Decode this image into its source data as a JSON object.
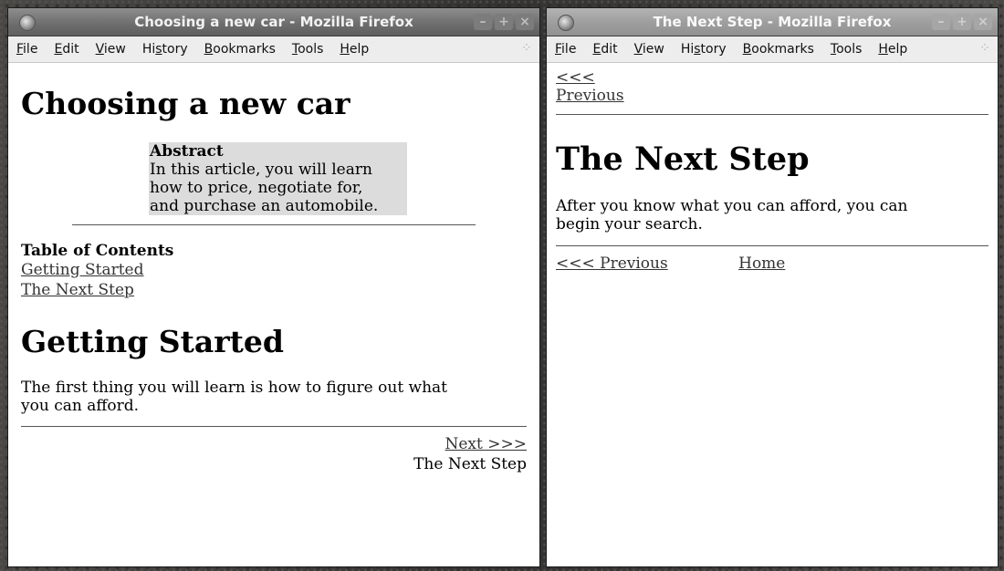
{
  "menu": {
    "items": [
      {
        "mnemonic": "F",
        "rest": "ile"
      },
      {
        "mnemonic": "E",
        "rest": "dit"
      },
      {
        "mnemonic": "V",
        "rest": "iew"
      },
      {
        "pre": "Hi",
        "mnemonic": "s",
        "rest": "tory"
      },
      {
        "mnemonic": "B",
        "rest": "ookmarks"
      },
      {
        "mnemonic": "T",
        "rest": "ools"
      },
      {
        "mnemonic": "H",
        "rest": "elp"
      }
    ]
  },
  "wm_buttons": {
    "minimize": "–",
    "maximize": "+",
    "close": "×"
  },
  "left_window": {
    "title": "Choosing a new car - Mozilla Firefox",
    "heading": "Choosing a new car",
    "abstract": {
      "heading": "Abstract",
      "lines": [
        "In this article, you will learn",
        "how to price, negotiate for,",
        "and purchase an automobile."
      ]
    },
    "toc": {
      "title": "Table of Contents",
      "links": [
        "Getting Started",
        "The Next Step"
      ]
    },
    "section_heading": "Getting Started",
    "paragraph": [
      "The first thing you will learn is how to figure out what",
      "you can afford."
    ],
    "nav": {
      "next_label": "Next >>>",
      "next_title": "The Next Step"
    }
  },
  "right_window": {
    "title": "The Next Step - Mozilla Firefox",
    "nav_top": {
      "arrows": "<<<",
      "previous": "Previous"
    },
    "heading": "The Next Step",
    "paragraph": [
      "After you know what you can afford, you can",
      "begin your search."
    ],
    "nav_bottom": {
      "previous": "<<< Previous",
      "home": "Home"
    }
  }
}
